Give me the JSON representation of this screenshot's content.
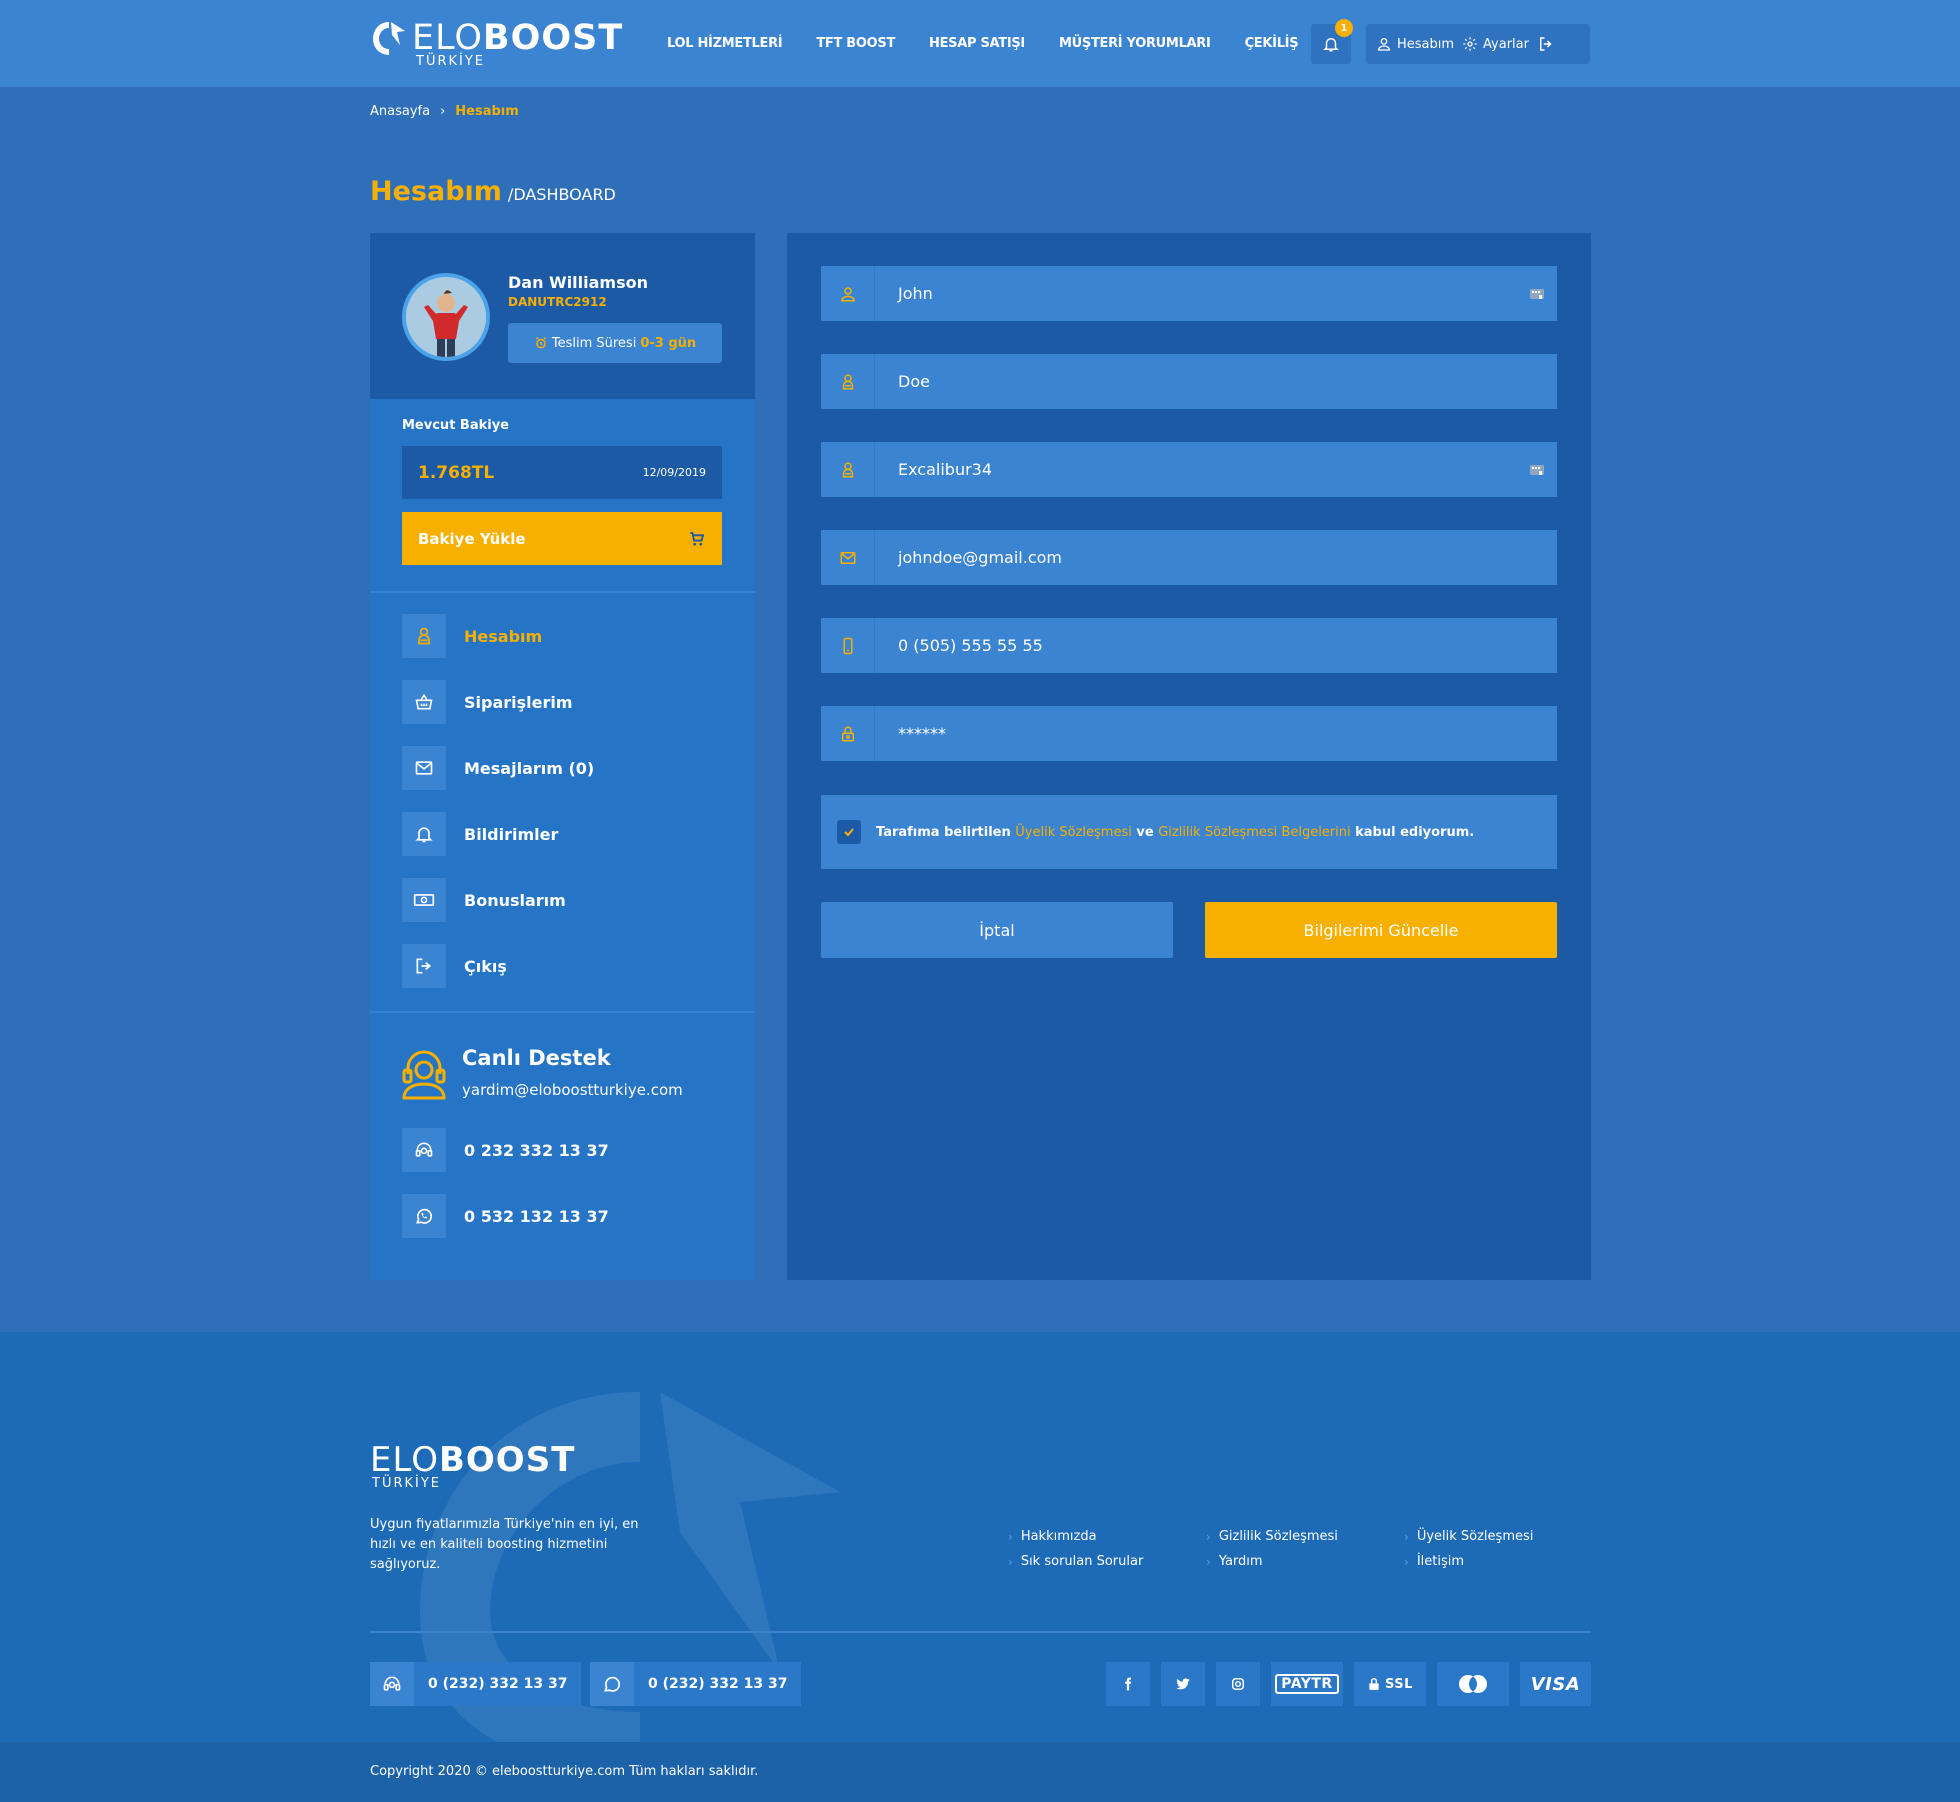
{
  "brand": {
    "logo_thin": "ELO",
    "logo_bold": "BOOST",
    "logo_sub": "TÜRKİYE"
  },
  "nav": {
    "items": [
      "LOL HİZMETLERİ",
      "TFT BOOST",
      "HESAP SATIŞI",
      "MÜŞTERİ YORUMLARI",
      "ÇEKİLİŞ"
    ]
  },
  "header": {
    "notification_count": "1",
    "account_label": "Hesabım",
    "settings_label": "Ayarlar"
  },
  "breadcrumb": {
    "home": "Anasayfa",
    "separator": "›",
    "current": "Hesabım"
  },
  "page": {
    "title": "Hesabım",
    "subtitle": "/DASHBOARD"
  },
  "profile": {
    "name": "Dan Williamson",
    "username": "DANUTRC2912",
    "delivery_label": "Teslim Süresi",
    "delivery_value": "0-3 gün"
  },
  "balance": {
    "label": "Mevcut Bakiye",
    "amount": "1.768TL",
    "date": "12/09/2019",
    "load_button": "Bakiye Yükle"
  },
  "menu": {
    "items": [
      {
        "label": "Hesabım",
        "icon": "user-icon",
        "active": true
      },
      {
        "label": "Siparişlerim",
        "icon": "basket-icon",
        "active": false
      },
      {
        "label": "Mesajlarım (0)",
        "icon": "mail-icon",
        "active": false
      },
      {
        "label": "Bildirimler",
        "icon": "bell-icon",
        "active": false
      },
      {
        "label": "Bonuslarım",
        "icon": "money-icon",
        "active": false
      },
      {
        "label": "Çıkış",
        "icon": "logout-icon",
        "active": false
      }
    ]
  },
  "support": {
    "title": "Canlı Destek",
    "email": "yardim@eloboostturkiye.com",
    "phone": "0 232 332 13 37",
    "whatsapp": "0 532 132 13 37"
  },
  "form": {
    "first_name": "John",
    "last_name": "Doe",
    "summoner": "Excalibur34",
    "email": "johndoe@gmail.com",
    "phone": "0 (505) 555 55 55",
    "password": "******",
    "terms_prefix": "Tarafıma belirtilen",
    "terms_link1": "Üyelik Sözleşmesi",
    "terms_and": "ve",
    "terms_link2": "Gizlilik Sözleşmesi Belgelerini",
    "terms_suffix": "kabul ediyorum.",
    "terms_checked": true,
    "cancel_button": "İptal",
    "update_button": "Bilgilerimi Güncelle"
  },
  "footer": {
    "description": "Uygun fiyatlarımızla Türkiye'nin en iyi, en hızlı ve en kaliteli boosting hizmetini sağlıyoruz.",
    "links": [
      "Hakkımızda",
      "Gizlilik Sözleşmesi",
      "Üyelik Sözleşmesi",
      "Sık sorulan Sorular",
      "Yardım",
      "İletişim"
    ],
    "phone": "0 (232) 332 13 37",
    "whatsapp": "0 (232) 332 13 37",
    "payment_labels": [
      "PAYTR",
      "SSL",
      "VISA"
    ],
    "copyright": "Copyright 2020 © eleboostturkiye.com Tüm hakları saklıdır."
  },
  "colors": {
    "accent": "#f7b000",
    "header_bg": "#3b84d1",
    "panel_dark": "#1d5aa6",
    "panel_mid": "#2574c6"
  }
}
